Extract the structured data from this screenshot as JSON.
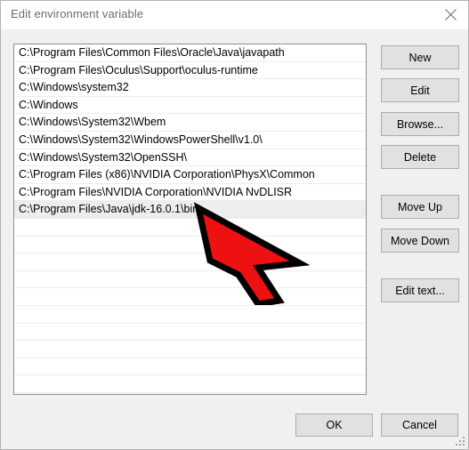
{
  "window": {
    "title": "Edit environment variable",
    "close_icon": "close-icon"
  },
  "path_list": {
    "entries": [
      "C:\\Program Files\\Common Files\\Oracle\\Java\\javapath",
      "C:\\Program Files\\Oculus\\Support\\oculus-runtime",
      "C:\\Windows\\system32",
      "C:\\Windows",
      "C:\\Windows\\System32\\Wbem",
      "C:\\Windows\\System32\\WindowsPowerShell\\v1.0\\",
      "C:\\Windows\\System32\\OpenSSH\\",
      "C:\\Program Files (x86)\\NVIDIA Corporation\\PhysX\\Common",
      "C:\\Program Files\\NVIDIA Corporation\\NVIDIA NvDLISR",
      "C:\\Program Files\\Java\\jdk-16.0.1\\bin"
    ],
    "selected_index": 9,
    "empty_row_count": 10
  },
  "side_buttons": {
    "new": "New",
    "edit": "Edit",
    "browse": "Browse...",
    "delete": "Delete",
    "move_up": "Move Up",
    "move_down": "Move Down",
    "edit_text": "Edit text..."
  },
  "footer_buttons": {
    "ok": "OK",
    "cancel": "Cancel"
  },
  "annotation": {
    "type": "arrow",
    "direction": "up-left",
    "fill_color": "#ee1111",
    "outline_color": "#000000",
    "points_at": "C:\\Program Files\\Java\\jdk-16.0.1\\bin"
  },
  "colors": {
    "dialog_background": "#f0f0f0",
    "titlebar_background": "#ffffff",
    "list_background": "#ffffff",
    "button_face": "#e1e1e1",
    "selection": "#ededed"
  }
}
